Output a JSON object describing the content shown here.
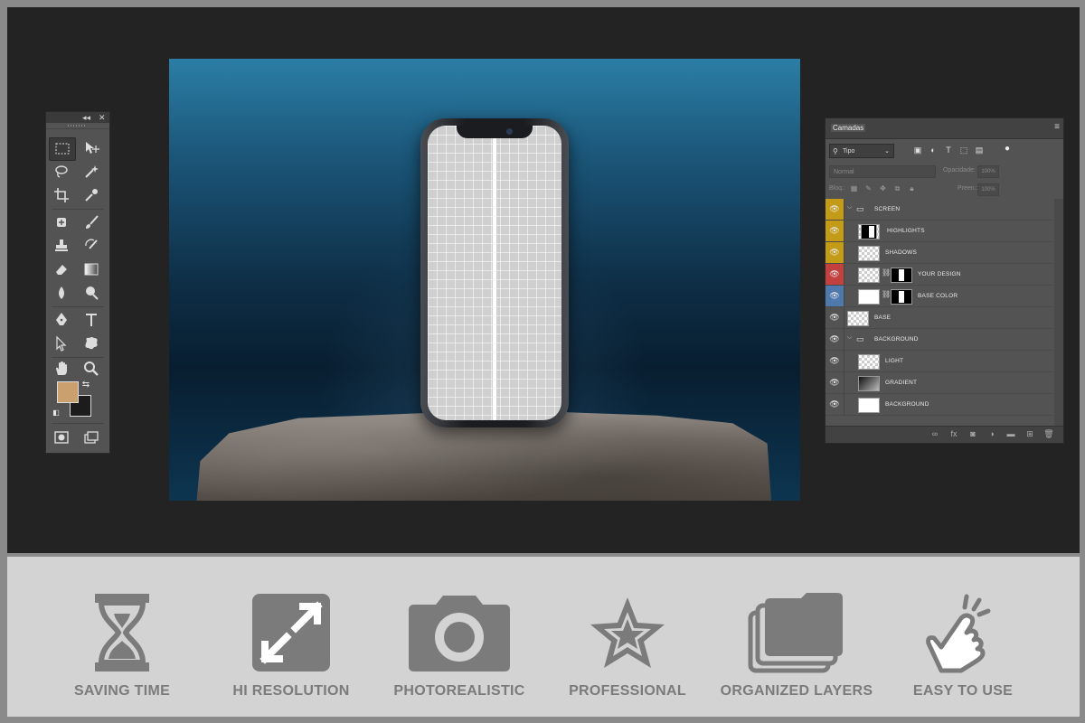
{
  "tools_panel": {
    "collapse_label": "◂◂",
    "close_label": "✕",
    "foreground_color": "#c9a06e",
    "background_color": "#1c1c1c"
  },
  "layers_panel": {
    "tab_label": "Camadas",
    "filter": {
      "selected": "Tipo"
    },
    "blend_mode": "Normal",
    "opacity_label": "Opacidade:",
    "opacity_value": "100%",
    "lock_label": "Bloq.:",
    "fill_label": "Preen.:",
    "fill_value": "100%",
    "layers": [
      {
        "name": "SCREEN",
        "kind": "group",
        "eye_color": "#c39b16",
        "indent": 1
      },
      {
        "name": "HIGHLIGHTS",
        "kind": "layer-mask",
        "eye_color": "#c39b16",
        "indent": 2
      },
      {
        "name": "SHADOWS",
        "kind": "layer",
        "eye_color": "#c39b16",
        "indent": 2
      },
      {
        "name": "YOUR DESIGN",
        "kind": "smart-mask",
        "eye_color": "#c2403d",
        "indent": 2
      },
      {
        "name": "BASE COLOR",
        "kind": "white-mask",
        "eye_color": "#4f79ad",
        "indent": 2
      },
      {
        "name": "BASE",
        "kind": "layer",
        "eye_color": "",
        "indent": 1
      },
      {
        "name": "BACKGROUND",
        "kind": "group",
        "eye_color": "",
        "indent": 1
      },
      {
        "name": "LIGHT",
        "kind": "layer",
        "eye_color": "",
        "indent": 2
      },
      {
        "name": "GRADIENT",
        "kind": "gradient",
        "eye_color": "",
        "indent": 2
      },
      {
        "name": "BACKGROUND",
        "kind": "white",
        "eye_color": "",
        "indent": 2
      }
    ]
  },
  "features": [
    {
      "label": "SAVING TIME",
      "icon": "hourglass-icon"
    },
    {
      "label": "HI RESOLUTION",
      "icon": "expand-icon"
    },
    {
      "label": "PHOTOREALISTIC",
      "icon": "camera-icon"
    },
    {
      "label": "PROFESSIONAL",
      "icon": "star-icon"
    },
    {
      "label": "ORGANIZED LAYERS",
      "icon": "layers-icon"
    },
    {
      "label": "EASY TO USE",
      "icon": "tap-hand-icon"
    }
  ],
  "colors": {
    "feature_gray": "#7b7b7b",
    "workspace": "#232323",
    "panel": "#535353"
  }
}
